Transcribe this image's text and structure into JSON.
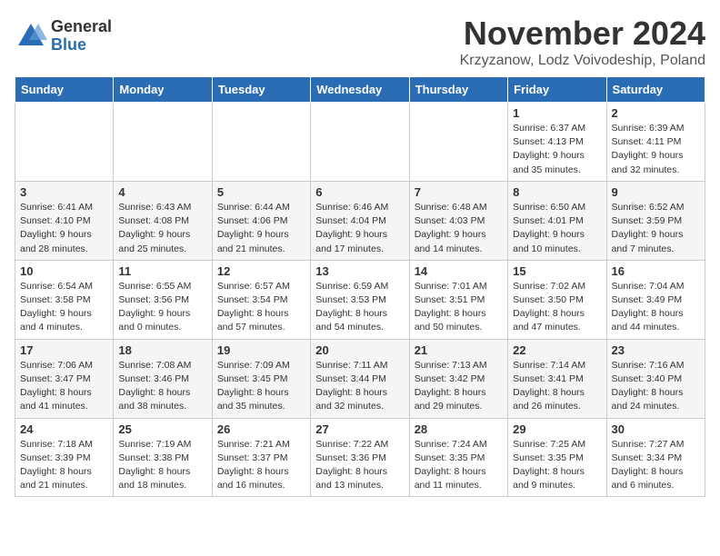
{
  "header": {
    "logo_general": "General",
    "logo_blue": "Blue",
    "month_title": "November 2024",
    "location": "Krzyzanow, Lodz Voivodeship, Poland"
  },
  "days_of_week": [
    "Sunday",
    "Monday",
    "Tuesday",
    "Wednesday",
    "Thursday",
    "Friday",
    "Saturday"
  ],
  "weeks": [
    [
      {
        "day": "",
        "info": ""
      },
      {
        "day": "",
        "info": ""
      },
      {
        "day": "",
        "info": ""
      },
      {
        "day": "",
        "info": ""
      },
      {
        "day": "",
        "info": ""
      },
      {
        "day": "1",
        "info": "Sunrise: 6:37 AM\nSunset: 4:13 PM\nDaylight: 9 hours\nand 35 minutes."
      },
      {
        "day": "2",
        "info": "Sunrise: 6:39 AM\nSunset: 4:11 PM\nDaylight: 9 hours\nand 32 minutes."
      }
    ],
    [
      {
        "day": "3",
        "info": "Sunrise: 6:41 AM\nSunset: 4:10 PM\nDaylight: 9 hours\nand 28 minutes."
      },
      {
        "day": "4",
        "info": "Sunrise: 6:43 AM\nSunset: 4:08 PM\nDaylight: 9 hours\nand 25 minutes."
      },
      {
        "day": "5",
        "info": "Sunrise: 6:44 AM\nSunset: 4:06 PM\nDaylight: 9 hours\nand 21 minutes."
      },
      {
        "day": "6",
        "info": "Sunrise: 6:46 AM\nSunset: 4:04 PM\nDaylight: 9 hours\nand 17 minutes."
      },
      {
        "day": "7",
        "info": "Sunrise: 6:48 AM\nSunset: 4:03 PM\nDaylight: 9 hours\nand 14 minutes."
      },
      {
        "day": "8",
        "info": "Sunrise: 6:50 AM\nSunset: 4:01 PM\nDaylight: 9 hours\nand 10 minutes."
      },
      {
        "day": "9",
        "info": "Sunrise: 6:52 AM\nSunset: 3:59 PM\nDaylight: 9 hours\nand 7 minutes."
      }
    ],
    [
      {
        "day": "10",
        "info": "Sunrise: 6:54 AM\nSunset: 3:58 PM\nDaylight: 9 hours\nand 4 minutes."
      },
      {
        "day": "11",
        "info": "Sunrise: 6:55 AM\nSunset: 3:56 PM\nDaylight: 9 hours\nand 0 minutes."
      },
      {
        "day": "12",
        "info": "Sunrise: 6:57 AM\nSunset: 3:54 PM\nDaylight: 8 hours\nand 57 minutes."
      },
      {
        "day": "13",
        "info": "Sunrise: 6:59 AM\nSunset: 3:53 PM\nDaylight: 8 hours\nand 54 minutes."
      },
      {
        "day": "14",
        "info": "Sunrise: 7:01 AM\nSunset: 3:51 PM\nDaylight: 8 hours\nand 50 minutes."
      },
      {
        "day": "15",
        "info": "Sunrise: 7:02 AM\nSunset: 3:50 PM\nDaylight: 8 hours\nand 47 minutes."
      },
      {
        "day": "16",
        "info": "Sunrise: 7:04 AM\nSunset: 3:49 PM\nDaylight: 8 hours\nand 44 minutes."
      }
    ],
    [
      {
        "day": "17",
        "info": "Sunrise: 7:06 AM\nSunset: 3:47 PM\nDaylight: 8 hours\nand 41 minutes."
      },
      {
        "day": "18",
        "info": "Sunrise: 7:08 AM\nSunset: 3:46 PM\nDaylight: 8 hours\nand 38 minutes."
      },
      {
        "day": "19",
        "info": "Sunrise: 7:09 AM\nSunset: 3:45 PM\nDaylight: 8 hours\nand 35 minutes."
      },
      {
        "day": "20",
        "info": "Sunrise: 7:11 AM\nSunset: 3:44 PM\nDaylight: 8 hours\nand 32 minutes."
      },
      {
        "day": "21",
        "info": "Sunrise: 7:13 AM\nSunset: 3:42 PM\nDaylight: 8 hours\nand 29 minutes."
      },
      {
        "day": "22",
        "info": "Sunrise: 7:14 AM\nSunset: 3:41 PM\nDaylight: 8 hours\nand 26 minutes."
      },
      {
        "day": "23",
        "info": "Sunrise: 7:16 AM\nSunset: 3:40 PM\nDaylight: 8 hours\nand 24 minutes."
      }
    ],
    [
      {
        "day": "24",
        "info": "Sunrise: 7:18 AM\nSunset: 3:39 PM\nDaylight: 8 hours\nand 21 minutes."
      },
      {
        "day": "25",
        "info": "Sunrise: 7:19 AM\nSunset: 3:38 PM\nDaylight: 8 hours\nand 18 minutes."
      },
      {
        "day": "26",
        "info": "Sunrise: 7:21 AM\nSunset: 3:37 PM\nDaylight: 8 hours\nand 16 minutes."
      },
      {
        "day": "27",
        "info": "Sunrise: 7:22 AM\nSunset: 3:36 PM\nDaylight: 8 hours\nand 13 minutes."
      },
      {
        "day": "28",
        "info": "Sunrise: 7:24 AM\nSunset: 3:35 PM\nDaylight: 8 hours\nand 11 minutes."
      },
      {
        "day": "29",
        "info": "Sunrise: 7:25 AM\nSunset: 3:35 PM\nDaylight: 8 hours\nand 9 minutes."
      },
      {
        "day": "30",
        "info": "Sunrise: 7:27 AM\nSunset: 3:34 PM\nDaylight: 8 hours\nand 6 minutes."
      }
    ]
  ]
}
